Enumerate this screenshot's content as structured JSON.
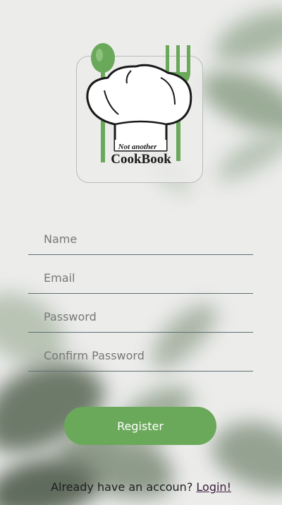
{
  "logo": {
    "line1": "Not another",
    "line2": "CookBook"
  },
  "form": {
    "name_placeholder": "Name",
    "email_placeholder": "Email",
    "password_placeholder": "Password",
    "confirm_password_placeholder": "Confirm Password",
    "register_label": "Register"
  },
  "footer": {
    "prompt": "Already have an accoun?",
    "login_link": "Login!"
  },
  "colors": {
    "accent_green": "#6aa85a",
    "background": "#ececeb",
    "underline": "#5f6f73",
    "link": "#3b1d3e"
  }
}
